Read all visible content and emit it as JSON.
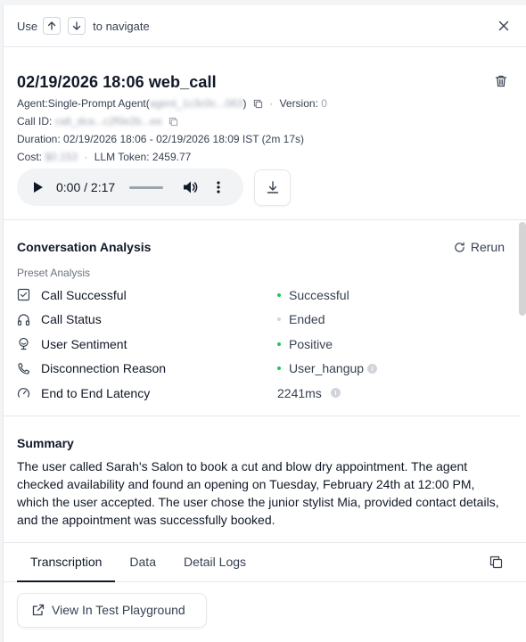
{
  "topbar": {
    "use_label": "Use",
    "navigate_label": "to navigate",
    "up_icon": "arrow-up-icon",
    "down_icon": "arrow-down-icon",
    "close_icon": "close-icon"
  },
  "call": {
    "title": "02/19/2026 18:06 web_call",
    "agent_label": "Agent:",
    "agent_name": "Single-Prompt Agent",
    "agent_id_open": "(",
    "agent_id": "agent_1c3c0c...063",
    "agent_id_close": ")",
    "version_label": "Version:",
    "version_value": "0",
    "call_id_label": "Call ID:",
    "call_id_value": "call_dca...c2f0e2b...ee",
    "duration_label": "Duration:",
    "duration_value": "02/19/2026 18:06 - 02/19/2026 18:09 IST (2m 17s)",
    "cost_label": "Cost:",
    "cost_value": "$0.153",
    "llm_token_label": "LLM Token:",
    "llm_token_value": "2459.77"
  },
  "audio": {
    "time": "0:00 / 2:17",
    "progress": 0
  },
  "analysis": {
    "title": "Conversation Analysis",
    "rerun_label": "Rerun",
    "preset_label": "Preset Analysis",
    "rows": [
      {
        "label": "Call Successful",
        "value": "Successful",
        "icon": "checkbox-icon",
        "dot_color": "#22c55e",
        "info": false
      },
      {
        "label": "Call Status",
        "value": "Ended",
        "icon": "headphones-icon",
        "dot_color": "#d1d5db",
        "info": false
      },
      {
        "label": "User Sentiment",
        "value": "Positive",
        "icon": "sentiment-icon",
        "dot_color": "#22c55e",
        "info": false
      },
      {
        "label": "Disconnection Reason",
        "value": "User_hangup",
        "icon": "phone-icon",
        "dot_color": "#22c55e",
        "info": true
      },
      {
        "label": "End to End Latency",
        "value": "2241ms",
        "icon": "gauge-icon",
        "dot_color": "",
        "info": true
      }
    ]
  },
  "summary": {
    "title": "Summary",
    "text": "The user called Sarah's Salon to book a cut and blow dry appointment. The agent checked availability and found an opening on Tuesday, February 24th at 12:00 PM, which the user accepted. The user chose the junior stylist Mia, provided contact details, and the appointment was successfully booked."
  },
  "tabs": [
    {
      "label": "Transcription",
      "active": true
    },
    {
      "label": "Data",
      "active": false
    },
    {
      "label": "Detail Logs",
      "active": false
    }
  ],
  "playground": {
    "label": "View In Test Playground"
  },
  "colors": {
    "success": "#22c55e",
    "neutral": "#d1d5db",
    "text": "#111827",
    "border": "#e5e7eb"
  }
}
